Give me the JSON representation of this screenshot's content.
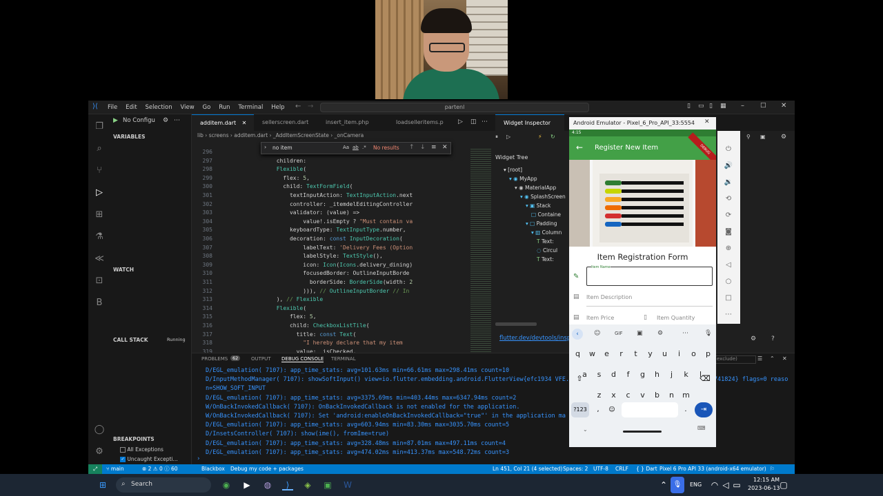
{
  "vscode": {
    "menu": [
      "File",
      "Edit",
      "Selection",
      "View",
      "Go",
      "Run",
      "Terminal",
      "Help"
    ],
    "command_center": "partenl",
    "run_config": "No Configu",
    "sidebar": {
      "variables": "VARIABLES",
      "watch": "WATCH",
      "call_stack": "CALL STACK",
      "call_stack_status": "Running",
      "breakpoints": "BREAKPOINTS",
      "bp_all": "All Exceptions",
      "bp_uncaught": "Uncaught Excepti..."
    },
    "tabs": [
      "additem.dart",
      "sellerscreen.dart",
      "insert_item.php",
      "loadselleritems.p",
      "Widget Inspector"
    ],
    "breadcrumb": "lib › screens › additem.dart › _AddItemScreenState › _onCamera",
    "find": {
      "value": "no item",
      "result": "No results",
      "aa": "Aa",
      "ab": "ab",
      "regex": ".*"
    },
    "line_numbers": [
      "296",
      "297",
      "298",
      "299",
      "300",
      "301",
      "302",
      "303",
      "304",
      "305",
      "306",
      "307",
      "308",
      "309",
      "310",
      "311",
      "312",
      "313",
      "314",
      "315",
      "316",
      "317",
      "318",
      "319"
    ],
    "code_lines": [
      "                        ",
      "                  children:",
      "                  Flexible(",
      "                    flex: 5,",
      "                    child: TextFormField(",
      "                      textInputAction: TextInputAction.next",
      "                      controller: _itemdelEditingController",
      "                      validator: (value) =>",
      "                          value!.isEmpty ? \"Must contain va",
      "                      keyboardType: TextInputType.number,",
      "                      decoration: const InputDecoration(",
      "                          labelText: 'Delivery Fees (Option",
      "                          labelStyle: TextStyle(),",
      "                          icon: Icon(Icons.delivery_dining)",
      "                          focusedBorder: OutlineInputBorde",
      "                            borderSide: BorderSide(width: 2",
      "                          ))), // OutlineInputBorder // In",
      "                  ), // Flexible",
      "                  Flexible(",
      "                      flex: 5,",
      "                      child: CheckboxListTile(",
      "                        title: const Text(",
      "                          \"I hereby declare that my item",
      "                        value:  isChecked,"
    ],
    "panel_tabs": [
      "PROBLEMS",
      "OUTPUT",
      "DEBUG CONSOLE",
      "TERMINAL"
    ],
    "problems_count": "62",
    "console_lines": [
      "D/EGL_emulation( 7107): app_time_stats: avg=101.63ms min=66.61ms max=298.41ms count=10",
      "D/InputMethodManager( 7107): showSoftInput() view=io.flutter.embedding.android.FlutterView{efc1934 VFE........ .F...ID 0,0-1080,2292 #1 aid=1073741824} flags=0 reaso",
      "n=SHOW_SOFT_INPUT",
      "D/EGL_emulation( 7107): app_time_stats: avg=3375.69ms min=403.44ms max=6347.94ms count=2",
      "W/OnBackInvokedCallback( 7107): OnBackInvokedCallback is not enabled for the application.",
      "W/OnBackInvokedCallback( 7107): Set 'android:enableOnBackInvokedCallback=\"true\"' in the application ma",
      "D/EGL_emulation( 7107): app_time_stats: avg=603.94ms min=83.30ms max=3035.70ms count=5",
      "D/InsetsController( 7107): show(ime(), fromIme=true)",
      "D/EGL_emulation( 7107): app_time_stats: avg=328.48ms min=87.01ms max=497.11ms count=4",
      "D/EGL_emulation( 7107): app_time_stats: avg=474.02ms min=413.37ms max=548.72ms count=3"
    ],
    "filter_placeholder": "exclude)",
    "widget_tree": {
      "title": "Widget Tree",
      "nodes": [
        "[root]",
        "MyApp",
        "MaterialApp",
        "SplashScreen",
        "Stack",
        "Containe",
        "Padding",
        "Column",
        "Text:",
        "Circul",
        "Text:"
      ]
    },
    "devtools_link": "flutter.dev/devtools/insp",
    "status": {
      "branch": "main",
      "errors": "2",
      "warnings": "0",
      "info": "60",
      "blackbox": "Blackbox",
      "debug": "Debug my code + packages",
      "position": "Ln 451, Col 21 (4 selected)",
      "spaces": "Spaces: 2",
      "encoding": "UTF-8",
      "eol": "CRLF",
      "language": "Dart",
      "device": "Pixel 6 Pro API 33 (android-x64 emulator)"
    }
  },
  "emulator": {
    "title": "Android Emulator - Pixel_6_Pro_API_33:5554",
    "time": "4:15",
    "app_title": "Register New Item",
    "debug_banner": "DEBUG",
    "form_title": "Item Registration Form",
    "fields": {
      "name_label": "Item Name",
      "desc_label": "Item Description",
      "price_label": "Item Price",
      "qty_label": "Item Quantity"
    },
    "kbd_toolbar": [
      "GIF"
    ],
    "rows": [
      [
        "q",
        "w",
        "e",
        "r",
        "t",
        "y",
        "u",
        "i",
        "o",
        "p"
      ],
      [
        "a",
        "s",
        "d",
        "f",
        "g",
        "h",
        "j",
        "k",
        "l"
      ],
      [
        "z",
        "x",
        "c",
        "v",
        "b",
        "n",
        "m"
      ]
    ],
    "num_key": "?123",
    "comma": ",",
    "period": "."
  },
  "taskbar": {
    "search": "Search",
    "lang": "ENG",
    "time": "12:15 AM",
    "date": "2023-06-13"
  }
}
